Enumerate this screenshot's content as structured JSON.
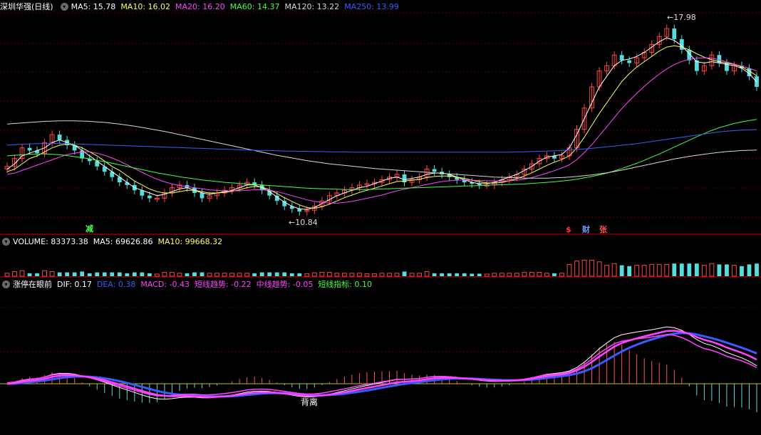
{
  "main": {
    "title": "深圳华强(日线)",
    "ma": [
      {
        "label": "MA5: 15.78",
        "color": "#ffffff"
      },
      {
        "label": "MA10: 16.02",
        "color": "#ffff55"
      },
      {
        "label": "MA20: 16.20",
        "color": "#ff44ff"
      },
      {
        "label": "MA60: 14.37",
        "color": "#44ff44"
      },
      {
        "label": "MA120: 13.22",
        "color": "#d8d8d8"
      },
      {
        "label": "MA250: 13.99",
        "color": "#3b5bff"
      }
    ],
    "high_label": "17.98",
    "low_label": "10.84",
    "markers": {
      "jian": "减",
      "dollar": "$",
      "cai": "财",
      "zhang": "张"
    }
  },
  "volume": {
    "items": [
      {
        "label": "VOLUME: 83373.38",
        "color": "#ffffff"
      },
      {
        "label": "MA5: 69626.86",
        "color": "#ffffff"
      },
      {
        "label": "MA10: 99668.32",
        "color": "#ffff55"
      }
    ]
  },
  "macd": {
    "items": [
      {
        "label": "涨停在眼前",
        "color": "#ffffff"
      },
      {
        "label": "DIF: 0.17",
        "color": "#ffffff"
      },
      {
        "label": "DEA: 0.38",
        "color": "#3b5bff"
      },
      {
        "label": "MACD: -0.43",
        "color": "#ff44ff"
      },
      {
        "label": "短线趋势: -0.22",
        "color": "#ff44ff"
      },
      {
        "label": "中线趋势: -0.05",
        "color": "#ff44ff"
      },
      {
        "label": "短线指标: 0.10",
        "color": "#44ff44"
      }
    ],
    "annotation": "背离"
  },
  "chart_data": {
    "type": "candlestick",
    "price_range": [
      10.84,
      17.98
    ],
    "close": [
      12.6,
      12.9,
      13.3,
      13.2,
      13.1,
      13.5,
      13.8,
      13.6,
      13.4,
      13.2,
      12.9,
      12.8,
      12.6,
      12.4,
      12.2,
      12.0,
      11.9,
      11.7,
      11.5,
      11.4,
      11.4,
      11.6,
      11.8,
      11.9,
      11.8,
      11.6,
      11.4,
      11.5,
      11.6,
      11.7,
      11.8,
      11.9,
      12.0,
      11.9,
      11.7,
      11.5,
      11.3,
      11.1,
      11.0,
      10.9,
      10.95,
      11.1,
      11.3,
      11.5,
      11.6,
      11.7,
      11.8,
      11.9,
      11.95,
      12.0,
      12.1,
      12.2,
      12.3,
      12.0,
      12.1,
      12.2,
      12.5,
      12.4,
      12.3,
      12.2,
      12.1,
      12.0,
      11.95,
      11.9,
      11.9,
      12.0,
      12.1,
      12.2,
      12.3,
      12.5,
      12.7,
      12.9,
      13.0,
      12.9,
      13.0,
      13.3,
      14.0,
      14.8,
      15.6,
      16.2,
      16.4,
      16.8,
      16.6,
      16.5,
      16.7,
      16.9,
      17.2,
      17.5,
      17.8,
      17.4,
      17.0,
      16.6,
      16.2,
      16.4,
      16.8,
      16.5,
      16.2,
      16.4,
      16.3,
      16.0,
      15.6
    ],
    "ma5": [
      12.5,
      12.7,
      13.0,
      13.1,
      13.2,
      13.3,
      13.5,
      13.6,
      13.5,
      13.4,
      13.2,
      13.0,
      12.8,
      12.6,
      12.4,
      12.2,
      12.0,
      11.8,
      11.7,
      11.6,
      11.5,
      11.55,
      11.65,
      11.75,
      11.8,
      11.7,
      11.6,
      11.55,
      11.6,
      11.65,
      11.7,
      11.8,
      11.9,
      11.9,
      11.8,
      11.65,
      11.45,
      11.25,
      11.1,
      11.0,
      10.98,
      11.05,
      11.2,
      11.35,
      11.5,
      11.6,
      11.7,
      11.8,
      11.85,
      11.95,
      12.05,
      12.15,
      12.2,
      12.1,
      12.15,
      12.2,
      12.3,
      12.35,
      12.35,
      12.3,
      12.2,
      12.1,
      12.0,
      11.95,
      11.95,
      12.0,
      12.1,
      12.2,
      12.3,
      12.45,
      12.6,
      12.8,
      12.95,
      13.0,
      13.05,
      13.3,
      13.8,
      14.4,
      15.0,
      15.6,
      16.0,
      16.4,
      16.6,
      16.65,
      16.75,
      16.9,
      17.1,
      17.3,
      17.45,
      17.35,
      17.15,
      16.85,
      16.55,
      16.5,
      16.55,
      16.5,
      16.45,
      16.4,
      16.3,
      16.1,
      15.78
    ],
    "ma10": [
      12.4,
      12.5,
      12.7,
      12.9,
      13.0,
      13.15,
      13.3,
      13.4,
      13.45,
      13.4,
      13.3,
      13.15,
      13.0,
      12.8,
      12.6,
      12.45,
      12.25,
      12.05,
      11.9,
      11.75,
      11.65,
      11.6,
      11.6,
      11.65,
      11.7,
      11.7,
      11.65,
      11.6,
      11.6,
      11.62,
      11.66,
      11.72,
      11.8,
      11.85,
      11.82,
      11.72,
      11.58,
      11.42,
      11.28,
      11.15,
      11.05,
      11.02,
      11.08,
      11.18,
      11.3,
      11.42,
      11.52,
      11.62,
      11.7,
      11.78,
      11.86,
      11.95,
      12.03,
      12.05,
      12.08,
      12.12,
      12.18,
      12.22,
      12.24,
      12.24,
      12.2,
      12.15,
      12.08,
      12.02,
      11.98,
      11.97,
      12.0,
      12.06,
      12.14,
      12.24,
      12.36,
      12.5,
      12.64,
      12.76,
      12.86,
      13.0,
      13.3,
      13.7,
      14.15,
      14.6,
      15.0,
      15.4,
      15.8,
      16.1,
      16.35,
      16.55,
      16.75,
      16.95,
      17.1,
      17.15,
      17.1,
      17.0,
      16.85,
      16.72,
      16.62,
      16.55,
      16.5,
      16.45,
      16.35,
      16.2,
      16.02
    ],
    "ma20": [
      12.3,
      12.35,
      12.45,
      12.55,
      12.65,
      12.75,
      12.85,
      12.95,
      13.05,
      13.1,
      13.15,
      13.15,
      13.1,
      13.02,
      12.92,
      12.8,
      12.66,
      12.52,
      12.38,
      12.24,
      12.12,
      12.02,
      11.94,
      11.88,
      11.84,
      11.8,
      11.76,
      11.72,
      11.7,
      11.68,
      11.68,
      11.68,
      11.7,
      11.72,
      11.72,
      11.7,
      11.65,
      11.58,
      11.5,
      11.42,
      11.34,
      11.28,
      11.24,
      11.22,
      11.22,
      11.24,
      11.28,
      11.34,
      11.4,
      11.46,
      11.52,
      11.6,
      11.68,
      11.74,
      11.8,
      11.86,
      11.92,
      11.98,
      12.03,
      12.06,
      12.08,
      12.09,
      12.08,
      12.07,
      12.06,
      12.05,
      12.05,
      12.06,
      12.08,
      12.12,
      12.18,
      12.26,
      12.35,
      12.44,
      12.54,
      12.66,
      12.86,
      13.12,
      13.42,
      13.76,
      14.1,
      14.44,
      14.78,
      15.08,
      15.36,
      15.62,
      15.86,
      16.08,
      16.28,
      16.44,
      16.56,
      16.64,
      16.68,
      16.7,
      16.68,
      16.62,
      16.54,
      16.46,
      16.38,
      16.3,
      16.2
    ],
    "ma60": [
      13.0,
      13.02,
      13.04,
      13.06,
      13.07,
      13.07,
      13.06,
      13.04,
      13.01,
      12.97,
      12.93,
      12.88,
      12.83,
      12.78,
      12.72,
      12.66,
      12.6,
      12.54,
      12.48,
      12.42,
      12.36,
      12.31,
      12.26,
      12.21,
      12.17,
      12.13,
      12.09,
      12.06,
      12.03,
      12.0,
      11.98,
      11.96,
      11.94,
      11.92,
      11.9,
      11.88,
      11.86,
      11.84,
      11.82,
      11.8,
      11.78,
      11.77,
      11.76,
      11.75,
      11.74,
      11.73,
      11.73,
      11.73,
      11.73,
      11.74,
      11.75,
      11.76,
      11.77,
      11.78,
      11.79,
      11.8,
      11.81,
      11.82,
      11.83,
      11.84,
      11.85,
      11.86,
      11.87,
      11.88,
      11.89,
      11.9,
      11.91,
      11.92,
      11.93,
      11.94,
      11.96,
      11.98,
      12.0,
      12.02,
      12.05,
      12.08,
      12.12,
      12.17,
      12.22,
      12.28,
      12.35,
      12.43,
      12.52,
      12.62,
      12.72,
      12.83,
      12.95,
      13.07,
      13.2,
      13.33,
      13.46,
      13.59,
      13.72,
      13.84,
      13.96,
      14.06,
      14.14,
      14.22,
      14.28,
      14.33,
      14.37
    ],
    "ma120": [
      14.2,
      14.22,
      14.24,
      14.26,
      14.28,
      14.3,
      14.31,
      14.32,
      14.32,
      14.32,
      14.31,
      14.3,
      14.28,
      14.26,
      14.23,
      14.2,
      14.16,
      14.12,
      14.07,
      14.02,
      13.97,
      13.92,
      13.86,
      13.8,
      13.74,
      13.68,
      13.62,
      13.56,
      13.5,
      13.44,
      13.38,
      13.32,
      13.26,
      13.2,
      13.14,
      13.08,
      13.02,
      12.97,
      12.92,
      12.87,
      12.82,
      12.78,
      12.74,
      12.7,
      12.67,
      12.64,
      12.61,
      12.58,
      12.55,
      12.52,
      12.5,
      12.48,
      12.46,
      12.44,
      12.42,
      12.4,
      12.38,
      12.36,
      12.34,
      12.32,
      12.3,
      12.28,
      12.26,
      12.24,
      12.22,
      12.2,
      12.19,
      12.18,
      12.17,
      12.16,
      12.16,
      12.16,
      12.16,
      12.17,
      12.18,
      12.2,
      12.22,
      12.25,
      12.28,
      12.32,
      12.36,
      12.41,
      12.46,
      12.52,
      12.58,
      12.64,
      12.7,
      12.76,
      12.82,
      12.88,
      12.93,
      12.98,
      13.02,
      13.06,
      13.1,
      13.13,
      13.16,
      13.18,
      13.2,
      13.21,
      13.22
    ],
    "ma250": [
      13.4,
      13.42,
      13.44,
      13.45,
      13.46,
      13.47,
      13.47,
      13.47,
      13.46,
      13.45,
      13.44,
      13.43,
      13.42,
      13.41,
      13.4,
      13.39,
      13.38,
      13.37,
      13.36,
      13.35,
      13.34,
      13.33,
      13.32,
      13.31,
      13.3,
      13.29,
      13.28,
      13.27,
      13.26,
      13.25,
      13.24,
      13.23,
      13.22,
      13.21,
      13.2,
      13.2,
      13.19,
      13.18,
      13.18,
      13.17,
      13.17,
      13.16,
      13.16,
      13.15,
      13.15,
      13.15,
      13.14,
      13.14,
      13.14,
      13.14,
      13.14,
      13.14,
      13.14,
      13.14,
      13.14,
      13.14,
      13.14,
      13.14,
      13.14,
      13.14,
      13.14,
      13.14,
      13.14,
      13.14,
      13.14,
      13.14,
      13.14,
      13.14,
      13.15,
      13.15,
      13.16,
      13.17,
      13.18,
      13.19,
      13.2,
      13.22,
      13.24,
      13.26,
      13.28,
      13.31,
      13.34,
      13.37,
      13.4,
      13.43,
      13.46,
      13.5,
      13.54,
      13.58,
      13.62,
      13.66,
      13.7,
      13.74,
      13.78,
      13.82,
      13.86,
      13.9,
      13.93,
      13.95,
      13.97,
      13.98,
      13.99
    ]
  }
}
